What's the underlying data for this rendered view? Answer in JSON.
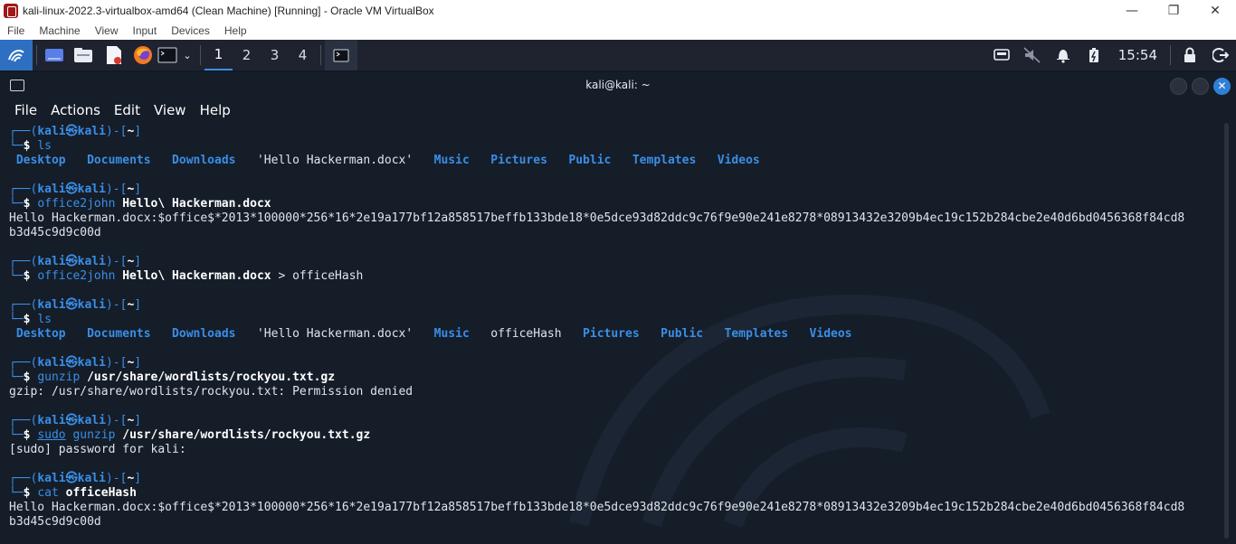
{
  "window": {
    "title": "kali-linux-2022.3-virtualbox-amd64 (Clean Machine) [Running] - Oracle VM VirtualBox"
  },
  "vbox_menu": [
    "File",
    "Machine",
    "View",
    "Input",
    "Devices",
    "Help"
  ],
  "panel": {
    "workspaces": [
      "1",
      "2",
      "3",
      "4"
    ],
    "active_workspace": "1",
    "clock": "15:54",
    "icons": [
      "kali-menu-icon",
      "show-desktop-icon",
      "file-manager-icon",
      "text-editor-icon",
      "firefox-icon",
      "terminal-icon",
      "terminal-dropdown-icon",
      "terminal-task-icon",
      "display-icon",
      "muted-speaker-icon",
      "bell-icon",
      "battery-icon",
      "lock-icon",
      "logout-icon"
    ]
  },
  "terminal": {
    "title": "kali@kali: ~",
    "menu": [
      "File",
      "Actions",
      "Edit",
      "View",
      "Help"
    ],
    "prompt": {
      "top_open": "┌──(",
      "user": "kali",
      "at": "㉿",
      "host": "kali",
      "mid": ")-[",
      "dir": "~",
      "close": "]",
      "bottom": "└─",
      "dollar": "$ "
    },
    "blocks": [
      {
        "cmd": "ls",
        "args": "",
        "suffix": "",
        "output_type": "ls",
        "ls": [
          "Desktop",
          "Documents",
          "Downloads",
          "'Hello Hackerman.docx'",
          "Music",
          "Pictures",
          "Public",
          "Templates",
          "Videos"
        ]
      },
      {
        "cmd": "office2john",
        "args": "Hello\\ Hackerman.docx",
        "suffix": "",
        "output_type": "text",
        "output": [
          "Hello Hackerman.docx:$office$*2013*100000*256*16*2e19a177bf12a858517beffb133bde18*0e5dce93d82ddc9c76f9e90e241e8278*08913432e3209b4ec19c152b284cbe2e40d6bd0456368f84cd8",
          "b3d45c9d9c00d"
        ]
      },
      {
        "cmd": "office2john",
        "args": "Hello\\ Hackerman.docx",
        "suffix": "> officeHash",
        "output_type": "none"
      },
      {
        "cmd": "ls",
        "args": "",
        "suffix": "",
        "output_type": "ls",
        "ls": [
          "Desktop",
          "Documents",
          "Downloads",
          "'Hello Hackerman.docx'",
          "Music",
          "officeHash",
          "Pictures",
          "Public",
          "Templates",
          "Videos"
        ]
      },
      {
        "cmd": "gunzip",
        "args": "/usr/share/wordlists/rockyou.txt.gz",
        "suffix": "",
        "output_type": "text",
        "output": [
          "gzip: /usr/share/wordlists/rockyou.txt: Permission denied"
        ]
      },
      {
        "cmd": "sudo gunzip",
        "args": "/usr/share/wordlists/rockyou.txt.gz",
        "suffix": "",
        "output_type": "text",
        "output": [
          "[sudo] password for kali:"
        ]
      },
      {
        "cmd": "cat",
        "args": "officeHash",
        "suffix": "",
        "output_type": "text",
        "output": [
          "Hello Hackerman.docx:$office$*2013*100000*256*16*2e19a177bf12a858517beffb133bde18*0e5dce93d82ddc9c76f9e90e241e8278*08913432e3209b4ec19c152b284cbe2e40d6bd0456368f84cd8",
          "b3d45c9d9c00d"
        ]
      }
    ]
  },
  "colors": {
    "accent": "#3a8ee6",
    "terminal_bg": "#151d29",
    "panel_bg": "#1f2330",
    "text": "#dfe4ea"
  }
}
